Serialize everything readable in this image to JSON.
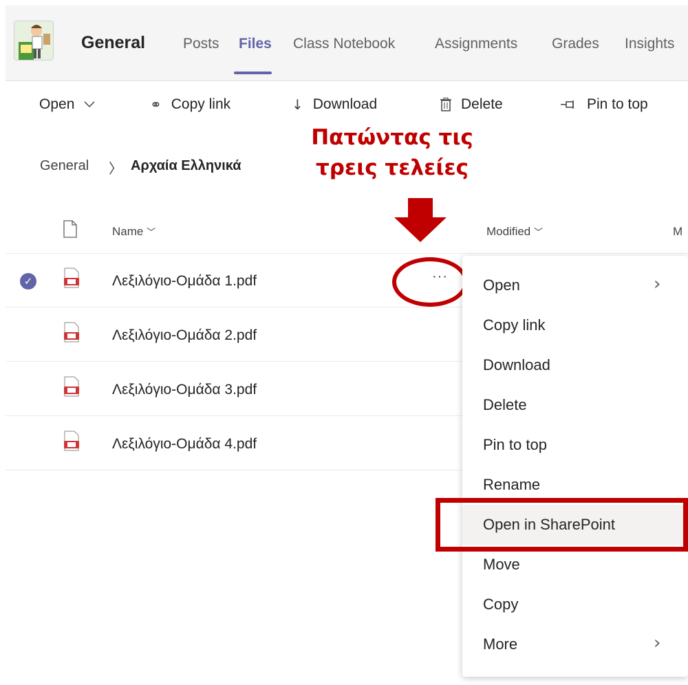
{
  "header": {
    "channel_name": "General",
    "tabs": [
      "Posts",
      "Files",
      "Class Notebook",
      "Assignments",
      "Grades",
      "Insights"
    ],
    "active_tab": "Files",
    "accent_color": "#6264a7"
  },
  "toolbar": {
    "open": "Open",
    "copy_link": "Copy link",
    "download": "Download",
    "delete": "Delete",
    "pin_to_top": "Pin to top"
  },
  "breadcrumb": {
    "root": "General",
    "current": "Αρχαία Ελληνικά"
  },
  "annotation": {
    "line1": "Πατώντας τις",
    "line2": "τρεις τελείες",
    "color": "#c00000"
  },
  "table": {
    "columns": {
      "name": "Name",
      "modified": "Modified",
      "modified_by_partial": "M"
    },
    "files": [
      {
        "name": "Λεξιλόγιο-Ομάδα 1.pdf",
        "selected": true
      },
      {
        "name": "Λεξιλόγιο-Ομάδα 2.pdf",
        "selected": false
      },
      {
        "name": "Λεξιλόγιο-Ομάδα 3.pdf",
        "selected": false
      },
      {
        "name": "Λεξιλόγιο-Ομάδα 4.pdf",
        "selected": false
      }
    ],
    "more_glyph": "···"
  },
  "context_menu": {
    "items": [
      {
        "label": "Open",
        "submenu": true
      },
      {
        "label": "Copy link",
        "submenu": false
      },
      {
        "label": "Download",
        "submenu": false
      },
      {
        "label": "Delete",
        "submenu": false
      },
      {
        "label": "Pin to top",
        "submenu": false
      },
      {
        "label": "Rename",
        "submenu": false
      },
      {
        "label": "Open in SharePoint",
        "submenu": false,
        "highlighted": true
      },
      {
        "label": "Move",
        "submenu": false
      },
      {
        "label": "Copy",
        "submenu": false
      },
      {
        "label": "More",
        "submenu": true
      }
    ]
  }
}
